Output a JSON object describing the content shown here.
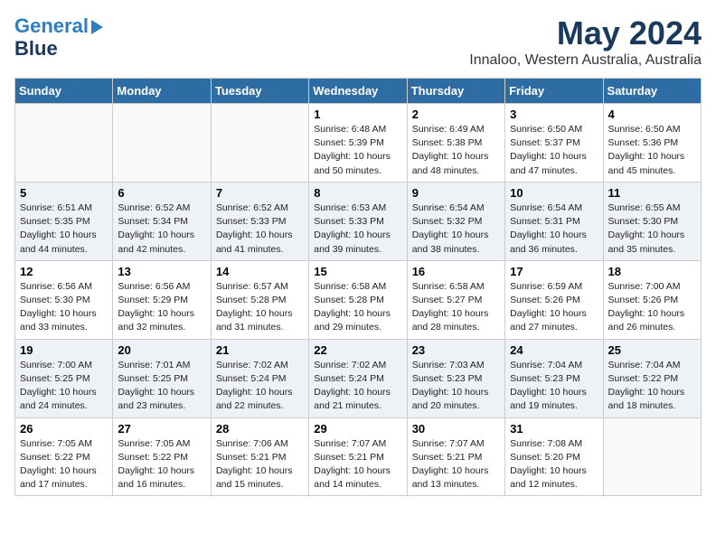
{
  "header": {
    "logo_line1": "General",
    "logo_line2": "Blue",
    "month": "May 2024",
    "location": "Innaloo, Western Australia, Australia"
  },
  "weekdays": [
    "Sunday",
    "Monday",
    "Tuesday",
    "Wednesday",
    "Thursday",
    "Friday",
    "Saturday"
  ],
  "weeks": [
    [
      {
        "day": "",
        "info": ""
      },
      {
        "day": "",
        "info": ""
      },
      {
        "day": "",
        "info": ""
      },
      {
        "day": "1",
        "info": "Sunrise: 6:48 AM\nSunset: 5:39 PM\nDaylight: 10 hours\nand 50 minutes."
      },
      {
        "day": "2",
        "info": "Sunrise: 6:49 AM\nSunset: 5:38 PM\nDaylight: 10 hours\nand 48 minutes."
      },
      {
        "day": "3",
        "info": "Sunrise: 6:50 AM\nSunset: 5:37 PM\nDaylight: 10 hours\nand 47 minutes."
      },
      {
        "day": "4",
        "info": "Sunrise: 6:50 AM\nSunset: 5:36 PM\nDaylight: 10 hours\nand 45 minutes."
      }
    ],
    [
      {
        "day": "5",
        "info": "Sunrise: 6:51 AM\nSunset: 5:35 PM\nDaylight: 10 hours\nand 44 minutes."
      },
      {
        "day": "6",
        "info": "Sunrise: 6:52 AM\nSunset: 5:34 PM\nDaylight: 10 hours\nand 42 minutes."
      },
      {
        "day": "7",
        "info": "Sunrise: 6:52 AM\nSunset: 5:33 PM\nDaylight: 10 hours\nand 41 minutes."
      },
      {
        "day": "8",
        "info": "Sunrise: 6:53 AM\nSunset: 5:33 PM\nDaylight: 10 hours\nand 39 minutes."
      },
      {
        "day": "9",
        "info": "Sunrise: 6:54 AM\nSunset: 5:32 PM\nDaylight: 10 hours\nand 38 minutes."
      },
      {
        "day": "10",
        "info": "Sunrise: 6:54 AM\nSunset: 5:31 PM\nDaylight: 10 hours\nand 36 minutes."
      },
      {
        "day": "11",
        "info": "Sunrise: 6:55 AM\nSunset: 5:30 PM\nDaylight: 10 hours\nand 35 minutes."
      }
    ],
    [
      {
        "day": "12",
        "info": "Sunrise: 6:56 AM\nSunset: 5:30 PM\nDaylight: 10 hours\nand 33 minutes."
      },
      {
        "day": "13",
        "info": "Sunrise: 6:56 AM\nSunset: 5:29 PM\nDaylight: 10 hours\nand 32 minutes."
      },
      {
        "day": "14",
        "info": "Sunrise: 6:57 AM\nSunset: 5:28 PM\nDaylight: 10 hours\nand 31 minutes."
      },
      {
        "day": "15",
        "info": "Sunrise: 6:58 AM\nSunset: 5:28 PM\nDaylight: 10 hours\nand 29 minutes."
      },
      {
        "day": "16",
        "info": "Sunrise: 6:58 AM\nSunset: 5:27 PM\nDaylight: 10 hours\nand 28 minutes."
      },
      {
        "day": "17",
        "info": "Sunrise: 6:59 AM\nSunset: 5:26 PM\nDaylight: 10 hours\nand 27 minutes."
      },
      {
        "day": "18",
        "info": "Sunrise: 7:00 AM\nSunset: 5:26 PM\nDaylight: 10 hours\nand 26 minutes."
      }
    ],
    [
      {
        "day": "19",
        "info": "Sunrise: 7:00 AM\nSunset: 5:25 PM\nDaylight: 10 hours\nand 24 minutes."
      },
      {
        "day": "20",
        "info": "Sunrise: 7:01 AM\nSunset: 5:25 PM\nDaylight: 10 hours\nand 23 minutes."
      },
      {
        "day": "21",
        "info": "Sunrise: 7:02 AM\nSunset: 5:24 PM\nDaylight: 10 hours\nand 22 minutes."
      },
      {
        "day": "22",
        "info": "Sunrise: 7:02 AM\nSunset: 5:24 PM\nDaylight: 10 hours\nand 21 minutes."
      },
      {
        "day": "23",
        "info": "Sunrise: 7:03 AM\nSunset: 5:23 PM\nDaylight: 10 hours\nand 20 minutes."
      },
      {
        "day": "24",
        "info": "Sunrise: 7:04 AM\nSunset: 5:23 PM\nDaylight: 10 hours\nand 19 minutes."
      },
      {
        "day": "25",
        "info": "Sunrise: 7:04 AM\nSunset: 5:22 PM\nDaylight: 10 hours\nand 18 minutes."
      }
    ],
    [
      {
        "day": "26",
        "info": "Sunrise: 7:05 AM\nSunset: 5:22 PM\nDaylight: 10 hours\nand 17 minutes."
      },
      {
        "day": "27",
        "info": "Sunrise: 7:05 AM\nSunset: 5:22 PM\nDaylight: 10 hours\nand 16 minutes."
      },
      {
        "day": "28",
        "info": "Sunrise: 7:06 AM\nSunset: 5:21 PM\nDaylight: 10 hours\nand 15 minutes."
      },
      {
        "day": "29",
        "info": "Sunrise: 7:07 AM\nSunset: 5:21 PM\nDaylight: 10 hours\nand 14 minutes."
      },
      {
        "day": "30",
        "info": "Sunrise: 7:07 AM\nSunset: 5:21 PM\nDaylight: 10 hours\nand 13 minutes."
      },
      {
        "day": "31",
        "info": "Sunrise: 7:08 AM\nSunset: 5:20 PM\nDaylight: 10 hours\nand 12 minutes."
      },
      {
        "day": "",
        "info": ""
      }
    ]
  ]
}
